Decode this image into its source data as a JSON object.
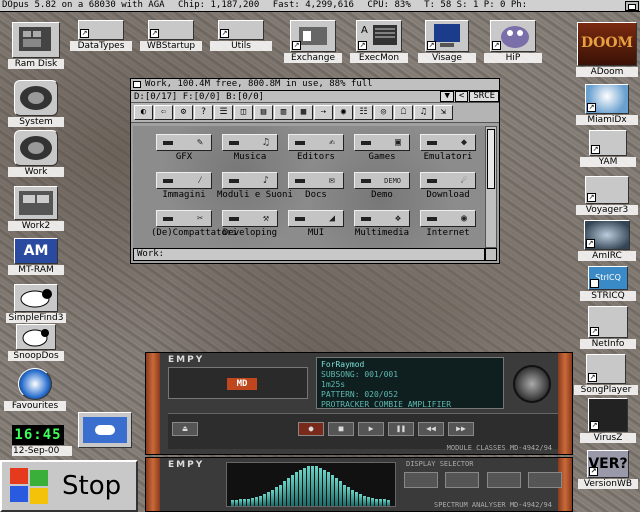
{
  "titlebar": {
    "app": "DOpus 5.82 on a 68030 with AGA",
    "chip": "Chip: 1,187,200",
    "fast": "Fast: 4,299,616",
    "cpu": "CPU: 83%",
    "tasks": "T: 58  S: 1  P: 0  Ph:"
  },
  "desktop_left": [
    {
      "label": "Ram Disk"
    },
    {
      "label": "System"
    },
    {
      "label": "Work"
    },
    {
      "label": "Work2"
    },
    {
      "label": "MT-RAM"
    },
    {
      "label": "SimpleFind3"
    },
    {
      "label": "SnoopDos"
    },
    {
      "label": "Favourites"
    }
  ],
  "desktop_top": [
    {
      "label": "DataTypes"
    },
    {
      "label": "WBStartup"
    },
    {
      "label": "Utils"
    },
    {
      "label": "Exchange"
    },
    {
      "label": "ExecMon"
    },
    {
      "label": "Visage"
    },
    {
      "label": "HiP"
    }
  ],
  "desktop_right": [
    {
      "label": "ADoom"
    },
    {
      "label": "MiamiDx"
    },
    {
      "label": "YAM"
    },
    {
      "label": "Voyager3"
    },
    {
      "label": "AmIRC"
    },
    {
      "label": "STRICQ"
    },
    {
      "label": "NetInfo"
    },
    {
      "label": "SongPlayer"
    },
    {
      "label": "VirusZ"
    },
    {
      "label": "VersionWB"
    }
  ],
  "lister": {
    "title": "Work,  100.4M free, 800.8M in use, 88% full",
    "path": "D:[0/17] F:[0/0] B:[0/0]",
    "parent_btn": "<",
    "srce": "SRCE",
    "status": "Work:",
    "toolbar": [
      "◐",
      "⇦",
      "⚙",
      "?",
      "☰",
      "◫",
      "▤",
      "▥",
      "▦",
      "⇢",
      "◉",
      "☷",
      "◎",
      "☖",
      "♫",
      "⇲"
    ],
    "folders": [
      {
        "label": "GFX"
      },
      {
        "label": "Musica"
      },
      {
        "label": "Editors"
      },
      {
        "label": "Games"
      },
      {
        "label": "Emulatori"
      },
      {
        "label": "Immagini"
      },
      {
        "label": "Moduli e Suoni"
      },
      {
        "label": "Docs"
      },
      {
        "label": "Demo"
      },
      {
        "label": "Download"
      },
      {
        "label": "(De)Compattatori"
      },
      {
        "label": "Developing"
      },
      {
        "label": "MUI"
      },
      {
        "label": "Multimedia"
      },
      {
        "label": "Internet"
      }
    ],
    "demo_badge": "DEMO"
  },
  "player": {
    "brand": "EMPY",
    "md": "MD",
    "lcd_title": "ForRaymod",
    "lcd_sub": "SUBSONG:  001/001",
    "lcd_time": "1m25s",
    "lcd_pattern": "PATTERN: 020/052",
    "lcd_footer": "PROTRACKER COMBIE AMPLIFIER",
    "model": "MODULE CLASSES MD-4942/94"
  },
  "analyzer": {
    "brand": "EMPY",
    "top": "DISPLAY SELECTOR",
    "model": "SPECTRUM ANALYSER MD-4942/94"
  },
  "clock": "16:45",
  "date": "12-Sep-00",
  "stop": "Stop"
}
